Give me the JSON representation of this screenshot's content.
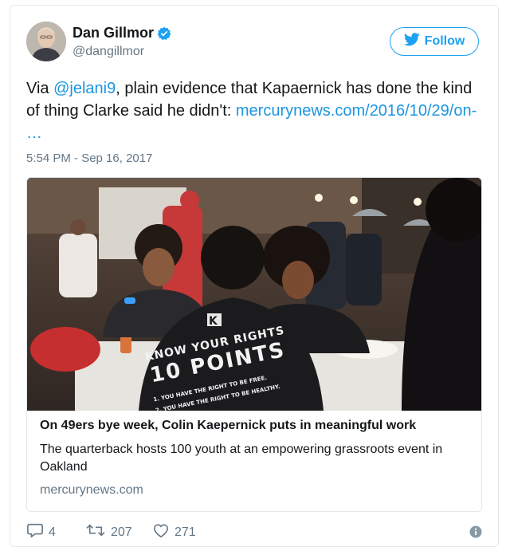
{
  "author": {
    "name": "Dan Gillmor",
    "handle": "@dangillmor",
    "avatar_icon": "person-portrait",
    "verified_icon": "verified-badge-icon"
  },
  "follow_button": {
    "label": "Follow",
    "icon": "twitter-bird-icon",
    "color": "#1da1f2"
  },
  "tweet": {
    "text_prefix": "Via ",
    "mention": "@jelani9",
    "text_middle": ", plain evidence that Kapaernick has done the kind of thing Clarke said he didn't: ",
    "link": "mercurynews.com/2016/10/29/on-",
    "link_ellipsis": "…",
    "timestamp": "5:54 PM - Sep 16, 2017",
    "link_color": "#1b95e0"
  },
  "link_card": {
    "image_shirt_line1": "KNOW YOUR RIGHTS",
    "image_shirt_line2": "10 POINTS",
    "image_shirt_line3": "1. YOU HAVE THE RIGHT TO BE FREE.",
    "image_shirt_line4": "2. YOU HAVE THE RIGHT TO BE HEALTHY.",
    "title": "On 49ers bye week, Colin Kaepernick puts in meaningful work",
    "description": "The quarterback hosts 100 youth at an empowering grassroots event in Oakland",
    "domain": "mercurynews.com"
  },
  "actions": {
    "reply_count": "4",
    "retweet_count": "207",
    "like_count": "271",
    "reply_icon": "reply-icon",
    "retweet_icon": "retweet-icon",
    "like_icon": "heart-icon",
    "info_icon": "info-icon"
  }
}
